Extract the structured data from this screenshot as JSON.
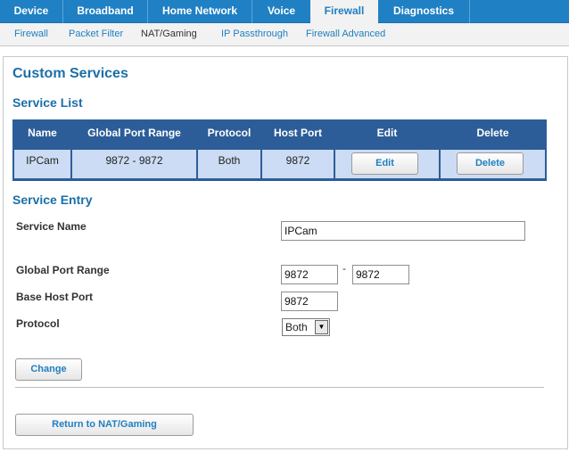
{
  "topnav": {
    "tabs": [
      {
        "label": "Device"
      },
      {
        "label": "Broadband"
      },
      {
        "label": "Home Network"
      },
      {
        "label": "Voice"
      },
      {
        "label": "Firewall"
      },
      {
        "label": "Diagnostics"
      }
    ],
    "active": "Firewall"
  },
  "subnav": {
    "items": [
      {
        "label": "Firewall"
      },
      {
        "label": "Packet Filter"
      },
      {
        "label": "NAT/Gaming"
      },
      {
        "label": "IP Passthrough"
      },
      {
        "label": "Firewall Advanced"
      }
    ],
    "active": "NAT/Gaming"
  },
  "page": {
    "title": "Custom Services",
    "service_list_heading": "Service List",
    "service_entry_heading": "Service Entry"
  },
  "service_table": {
    "headers": [
      "Name",
      "Global Port Range",
      "Protocol",
      "Host Port",
      "Edit",
      "Delete"
    ],
    "rows": [
      {
        "name": "IPCam",
        "global_port_range": "9872 - 9872",
        "protocol": "Both",
        "host_port": "9872",
        "edit_label": "Edit",
        "delete_label": "Delete"
      }
    ]
  },
  "form": {
    "service_name_label": "Service Name",
    "service_name_value": "IPCam",
    "global_port_range_label": "Global Port Range",
    "port_start_value": "9872",
    "range_separator": "-",
    "port_end_value": "9872",
    "base_host_port_label": "Base Host Port",
    "base_host_port_value": "9872",
    "protocol_label": "Protocol",
    "protocol_selected": "Both",
    "change_label": "Change",
    "return_label": "Return to NAT/Gaming"
  },
  "colors": {
    "topnav_bg": "#1f80c4",
    "accent_text": "#1b6fa8",
    "table_header_bg": "#2d5d98",
    "table_cell_bg": "#ccdcf4"
  }
}
